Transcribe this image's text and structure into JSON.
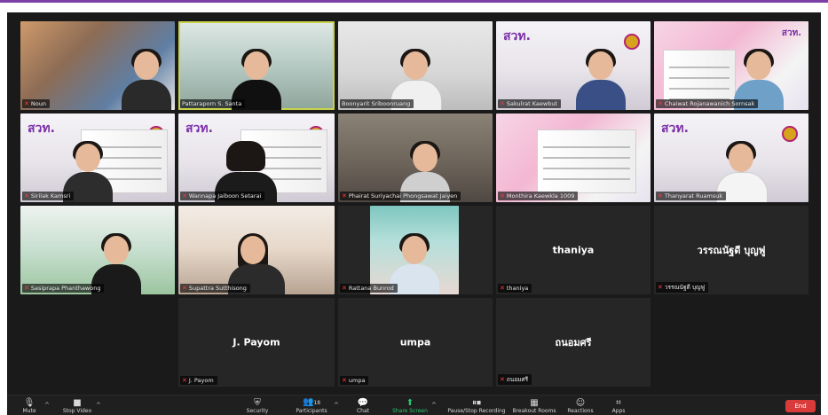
{
  "participants": [
    {
      "name": "Noun",
      "muted": true
    },
    {
      "name": "Pattaraporn S. Santa",
      "muted": false
    },
    {
      "name": "Boonyarit Sriboonruang",
      "muted": false
    },
    {
      "name": "Sakulrat Kaewbut",
      "muted": true
    },
    {
      "name": "Chaiwat Rojanawanich Sornsak",
      "muted": true
    },
    {
      "name": "Sirilak Kamsri",
      "muted": true
    },
    {
      "name": "Wannapa Jaiboon Setarai",
      "muted": true
    },
    {
      "name": "Phairat Suriyachai Phongsawat Jaiyen",
      "muted": true
    },
    {
      "name": "Monthira Kaewkla 1009",
      "muted": true
    },
    {
      "name": "Thanyarat Ruamsuk",
      "muted": true
    },
    {
      "name": "Sasiprapa Phanthawong",
      "muted": true
    },
    {
      "name": "Supattra Sutthisong",
      "muted": true
    },
    {
      "name": "Rattana Bunrod",
      "muted": true
    },
    {
      "name": "thaniya",
      "muted": true,
      "display": "thaniya"
    },
    {
      "name": "วรรณนัฐดี บุญฟู",
      "muted": true,
      "display": "วรรณนัฐดี บุญฟู"
    },
    {
      "name": "J. Payom",
      "muted": true,
      "display": "J. Payom"
    },
    {
      "name": "umpa",
      "muted": true,
      "display": "umpa"
    },
    {
      "name": "ถนอมศรี",
      "muted": true,
      "display": "ถนอมศรี"
    }
  ],
  "toolbar": {
    "mute": "Mute",
    "stop_video": "Stop Video",
    "security": "Security",
    "participants": "Participants",
    "participants_count": "18",
    "chat": "Chat",
    "share_screen": "Share Screen",
    "recording": "Pause/Stop Recording",
    "breakout": "Breakout Rooms",
    "reactions": "Reactions",
    "apps": "Apps",
    "end": "End"
  },
  "branding": {
    "logo_text": "สวท."
  },
  "colors": {
    "accent_top": "#7b3fa6",
    "active_speaker": "#c9d34a",
    "end_button": "#d93b3b",
    "share_screen": "#28c76f"
  }
}
